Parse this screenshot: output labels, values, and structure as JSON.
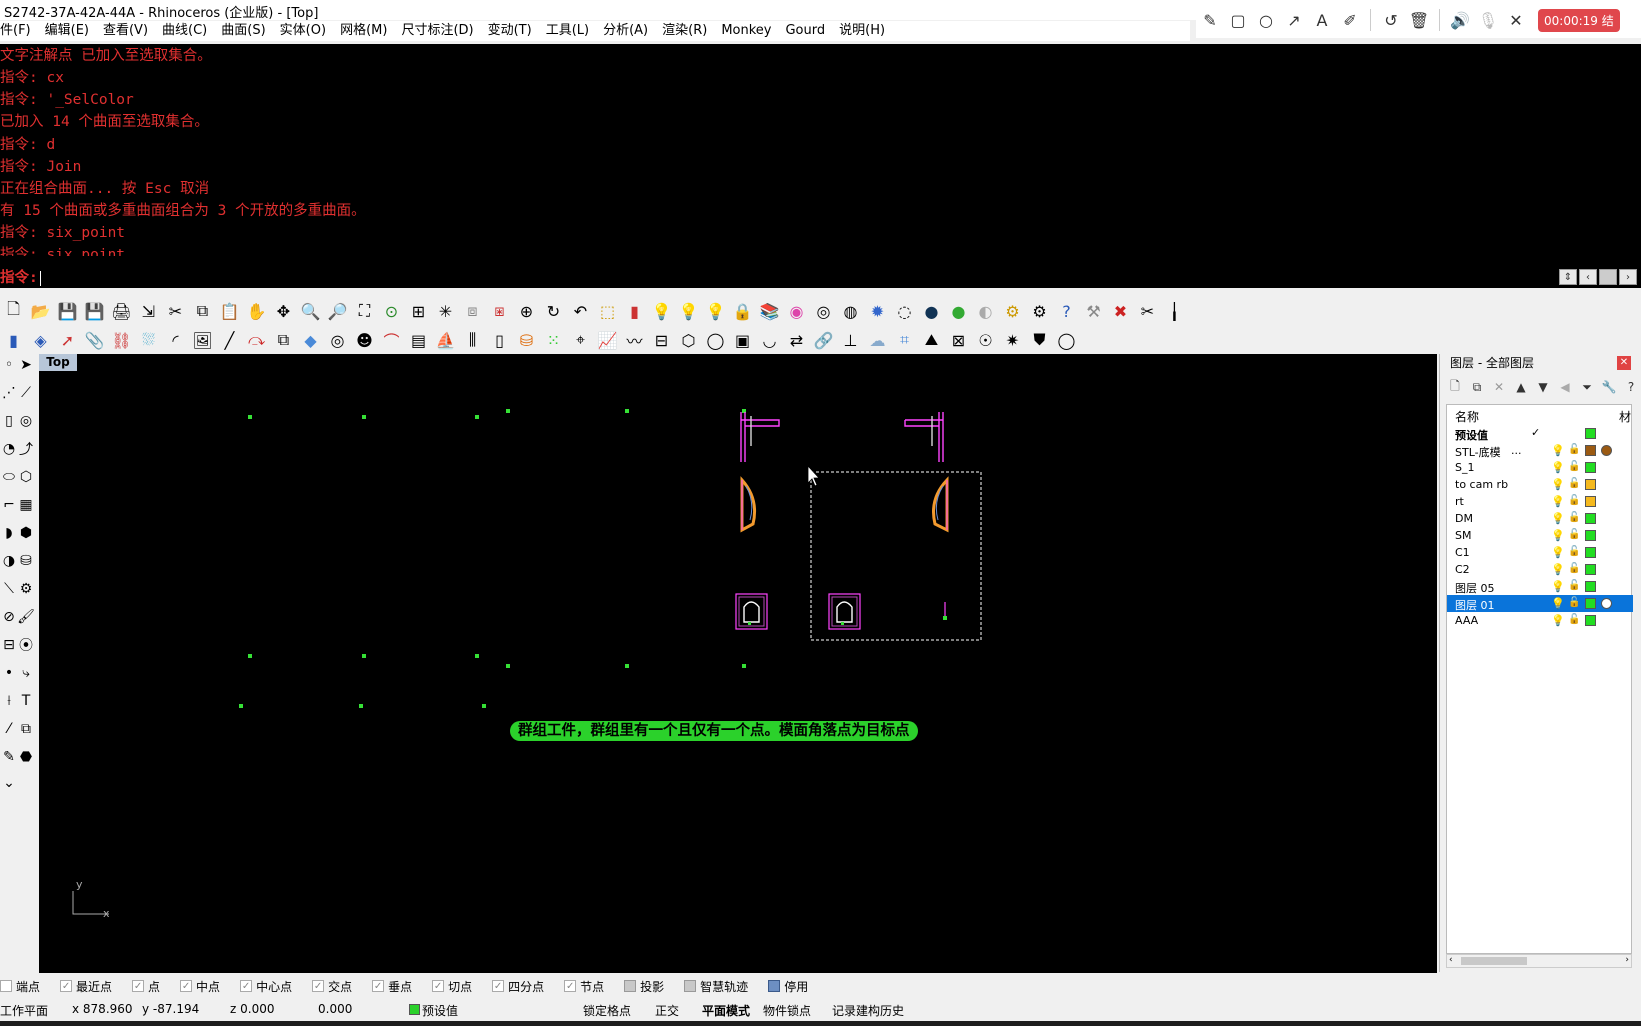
{
  "window": {
    "title": "S2742-37A-42A-44A - Rhinoceros (企业版) - [Top]"
  },
  "menu": [
    "件(F)",
    "编辑(E)",
    "查看(V)",
    "曲线(C)",
    "曲面(S)",
    "实体(O)",
    "网格(M)",
    "尺寸标注(D)",
    "变动(T)",
    "工具(L)",
    "分析(A)",
    "渲染(R)",
    "Monkey",
    "Gourd",
    "说明(H)"
  ],
  "recorder": {
    "timer": "00:00:19 结"
  },
  "command": {
    "lines": [
      "文字注解点 已加入至选取集合。",
      "指令: cx",
      "指令: '_SelColor",
      "已加入 14 个曲面至选取集合。",
      "指令: d",
      "指令: Join",
      "正在组合曲面... 按 Esc 取消",
      "有 15 个曲面或多重曲面组合为 3 个开放的多重曲面。",
      "指令: six_point",
      "指令: six_point"
    ],
    "prompt": "指令:"
  },
  "viewport": {
    "tab": "Top",
    "banner": "群组工件，群组里有一个且仅有一个点。模面角落点为目标点",
    "axis_y": "y",
    "axis_x": "x"
  },
  "layers": {
    "header": "图层 - 全部图层",
    "col_name": "名称",
    "col_mat": "材",
    "rows": [
      {
        "name": "预设值",
        "check": "✓",
        "color": "#22dd22",
        "bold": true
      },
      {
        "name": "STL-底模",
        "extra": "...",
        "color": "#9b5a12",
        "mat": "#9b5a12"
      },
      {
        "name": "S_1",
        "color": "#22dd22"
      },
      {
        "name": "to cam rb",
        "color": "#f5b91e"
      },
      {
        "name": "rt",
        "color": "#f5b91e"
      },
      {
        "name": "DM",
        "color": "#22dd22"
      },
      {
        "name": "SM",
        "color": "#22dd22"
      },
      {
        "name": "C1",
        "color": "#22dd22"
      },
      {
        "name": "C2",
        "color": "#22dd22"
      },
      {
        "name": "图层 05",
        "color": "#22dd22"
      },
      {
        "name": "图层 01",
        "color": "#22dd22",
        "selected": true,
        "mat": "#ffffff"
      },
      {
        "name": "AAA",
        "color": "#22dd22"
      }
    ]
  },
  "osnaps": [
    {
      "label": "端点",
      "checked": false
    },
    {
      "label": "最近点",
      "checked": true
    },
    {
      "label": "点",
      "checked": true
    },
    {
      "label": "中点",
      "checked": true
    },
    {
      "label": "中心点",
      "checked": true
    },
    {
      "label": "交点",
      "checked": true
    },
    {
      "label": "垂点",
      "checked": true
    },
    {
      "label": "切点",
      "checked": true
    },
    {
      "label": "四分点",
      "checked": true
    },
    {
      "label": "节点",
      "checked": true
    },
    {
      "label": "投影",
      "style": "gray"
    },
    {
      "label": "智慧轨迹",
      "style": "gray"
    },
    {
      "label": "停用",
      "style": "blue"
    }
  ],
  "status": {
    "cplane": "工作平面",
    "x": "x 878.960",
    "y": "y -87.194",
    "z": "z 0.000",
    "dist": "0.000",
    "layer": "预设值",
    "panes": [
      "锁定格点",
      "正交",
      "平面模式",
      "物件锁点",
      "记录建构历史"
    ]
  }
}
